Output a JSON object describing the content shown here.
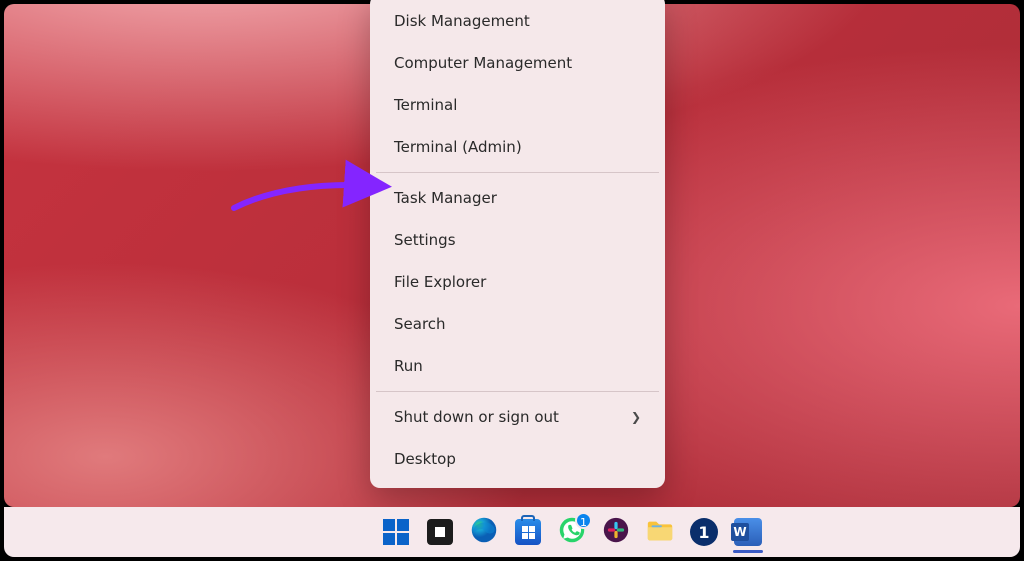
{
  "context_menu": {
    "group1": [
      {
        "label": "Disk Management"
      },
      {
        "label": "Computer Management"
      },
      {
        "label": "Terminal"
      },
      {
        "label": "Terminal (Admin)"
      }
    ],
    "group2": [
      {
        "label": "Task Manager"
      },
      {
        "label": "Settings"
      },
      {
        "label": "File Explorer"
      },
      {
        "label": "Search"
      },
      {
        "label": "Run"
      }
    ],
    "group3": [
      {
        "label": "Shut down or sign out",
        "submenu": true
      },
      {
        "label": "Desktop"
      }
    ]
  },
  "taskbar": {
    "whatsapp_badge": "1",
    "onepassword_label": "1",
    "word_label": "W"
  },
  "colors": {
    "accent": "#8425ff",
    "menu_bg": "#f5e8ea",
    "taskbar_bg": "#f6e9ec"
  }
}
